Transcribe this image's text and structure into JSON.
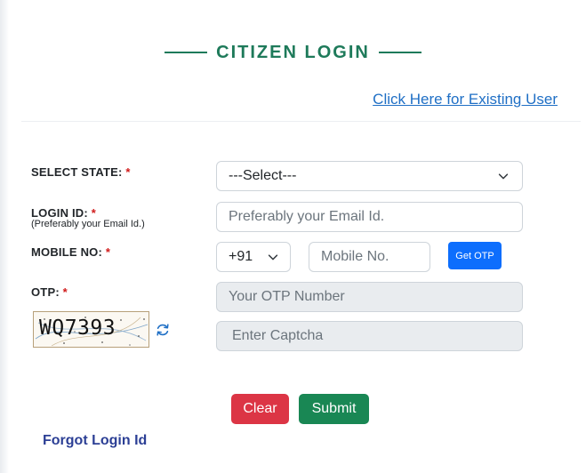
{
  "header": {
    "title": "CITIZEN LOGIN",
    "existing_user_link": "Click Here for Existing User"
  },
  "form": {
    "state": {
      "label": "SELECT STATE:",
      "required": "*",
      "selected": "---Select---"
    },
    "login_id": {
      "label": "LOGIN ID:",
      "required": "*",
      "hint": "(Preferably your Email Id.)",
      "placeholder": "Preferably your Email Id."
    },
    "mobile": {
      "label": "MOBILE NO:",
      "required": "*",
      "country_code": "+91",
      "placeholder": "Mobile No.",
      "otp_button": "Get OTP"
    },
    "otp": {
      "label": "OTP:",
      "required": "*",
      "placeholder": "Your OTP Number"
    },
    "captcha": {
      "image_text": "WQ7393",
      "placeholder": "Enter Captcha"
    }
  },
  "actions": {
    "clear": "Clear",
    "submit": "Submit"
  },
  "footer": {
    "forgot_link": "Forgot Login Id"
  },
  "colors": {
    "title": "#1e7a5a",
    "link": "#1f6fc5",
    "required": "#d01a1a",
    "otp_button": "#0d6efd",
    "clear": "#dc3545",
    "submit": "#198754",
    "forgot": "#2c3f95"
  }
}
